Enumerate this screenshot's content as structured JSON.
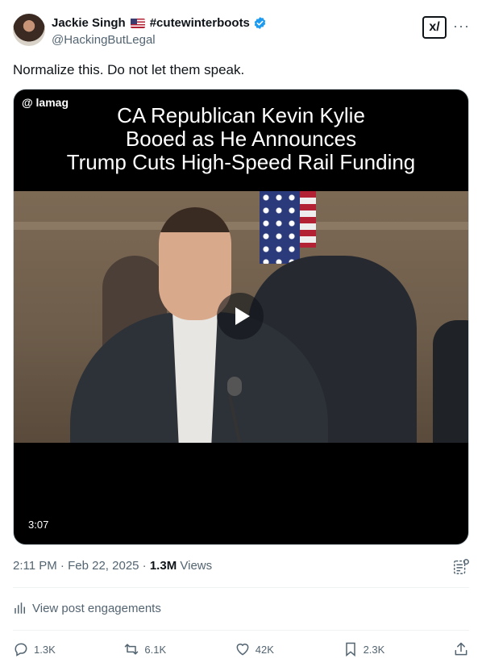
{
  "author": {
    "display_name": "Jackie Singh",
    "flag_icon": "us-flag-icon",
    "hashtag": "#cutewinterboots",
    "verified": true,
    "handle": "@HackingButLegal"
  },
  "header_actions": {
    "grok_label": "x/",
    "more_label": "···"
  },
  "post": {
    "text": "Normalize this. Do not let them speak."
  },
  "video": {
    "watermark": "@ lamag",
    "headline_line1": "CA Republican Kevin Kylie",
    "headline_line2": "Booed as He Announces",
    "headline_line3": "Trump Cuts High-Speed Rail Funding",
    "duration": "3:07"
  },
  "meta": {
    "time": "2:11 PM",
    "date": "Feb 22, 2025",
    "views_count": "1.3M",
    "views_label": "Views",
    "separator": "·"
  },
  "engagements": {
    "label": "View post engagements"
  },
  "actions": {
    "replies": "1.3K",
    "reposts": "6.1K",
    "likes": "42K",
    "bookmarks": "2.3K"
  },
  "colors": {
    "text": "#0f1419",
    "secondary": "#536471",
    "verified_blue": "#1d9bf0",
    "divider": "#eff3f4"
  }
}
